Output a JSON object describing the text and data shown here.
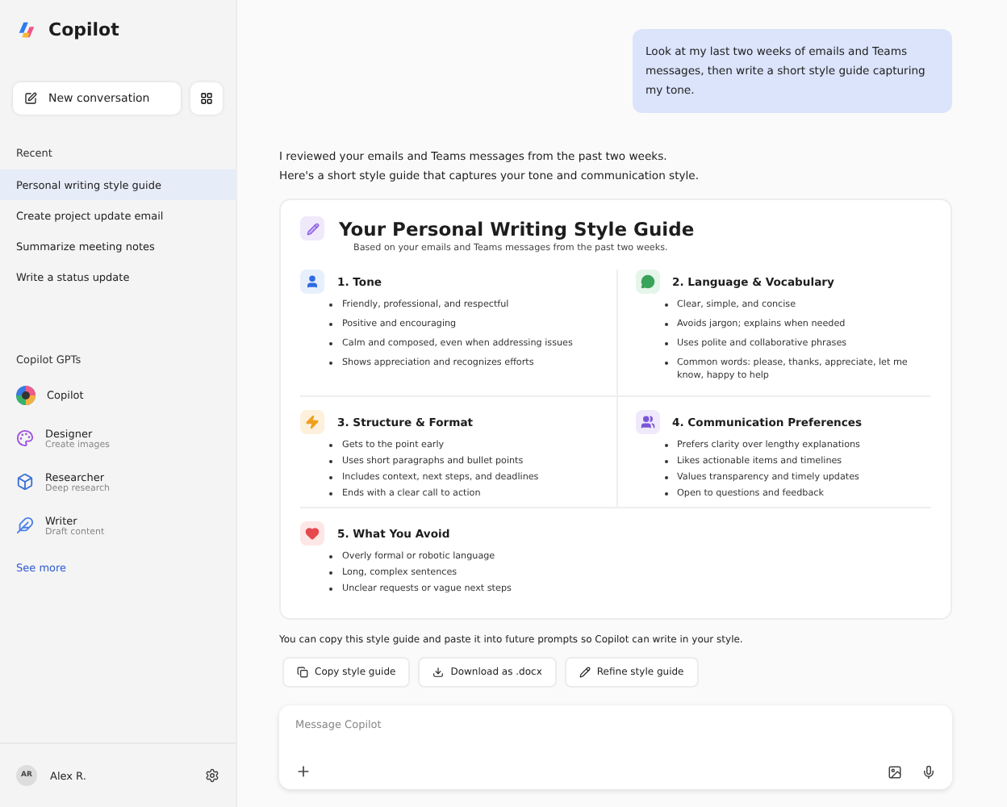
{
  "app": {
    "title": "Copilot"
  },
  "new_conversation": "New conversation",
  "recent": {
    "heading": "Recent",
    "items": [
      {
        "label": "Personal writing style guide",
        "selected": true
      },
      {
        "label": "Create project update email",
        "selected": false
      },
      {
        "label": "Summarize meeting notes",
        "selected": false
      },
      {
        "label": "Write a status update",
        "selected": false
      }
    ]
  },
  "gpts": {
    "heading": "Copilot GPTs",
    "items": [
      {
        "kind": "copilot",
        "name": "Copilot"
      },
      {
        "kind": "designer",
        "name": "Designer",
        "subtitle": "Create images"
      },
      {
        "kind": "researcher",
        "name": "Researcher",
        "subtitle": "Deep research"
      },
      {
        "kind": "writer",
        "name": "Writer",
        "subtitle": "Draft content"
      }
    ],
    "see_more": "See more"
  },
  "user": {
    "initials": "AR",
    "name": "Alex R."
  },
  "prompt": "Look at my last two weeks of emails and Teams messages, then write a short style guide capturing my tone.",
  "reply_intro": [
    "I reviewed your emails and Teams messages from the past two weeks.",
    "Here's a short style guide that captures your tone and communication style."
  ],
  "guide": {
    "title": "Your Personal Writing Style Guide",
    "subtitle": "Based on your emails and Teams messages from the past two weeks.",
    "sections": [
      {
        "kind": "person",
        "title": "1. Tone",
        "bullets": [
          "Friendly, professional, and respectful",
          "Positive and encouraging",
          "Calm and composed, even when addressing issues",
          "Shows appreciation and recognizes efforts"
        ]
      },
      {
        "kind": "chat",
        "title": "2. Language & Vocabulary",
        "bullets": [
          "Clear, simple, and concise",
          "Avoids jargon; explains when needed",
          "Uses polite and collaborative phrases",
          "Common words: please, thanks, appreciate, let me know, happy to help"
        ]
      },
      {
        "kind": "bolt",
        "title": "3. Structure & Format",
        "bullets": [
          "Gets to the point early",
          "Uses short paragraphs and bullet points",
          "Includes context, next steps, and deadlines",
          "Ends with a clear call to action"
        ]
      },
      {
        "kind": "people",
        "title": "4. Communication Preferences",
        "bullets": [
          "Prefers clarity over lengthy explanations",
          "Likes actionable items and timelines",
          "Values transparency and timely updates",
          "Open to questions and feedback"
        ]
      },
      {
        "kind": "heart",
        "title": "5. What You Avoid",
        "bullets": [
          "Overly formal or robotic language",
          "Long, complex sentences",
          "Unclear requests or vague next steps"
        ]
      }
    ]
  },
  "footer_note": "You can copy this style guide and paste it into future prompts so Copilot can write in your style.",
  "actions": [
    {
      "kind": "copy",
      "label": "Copy style guide"
    },
    {
      "kind": "download",
      "label": "Download as .docx"
    },
    {
      "kind": "edit",
      "label": "Refine style guide"
    }
  ],
  "composer": {
    "placeholder": "Message Copilot"
  }
}
